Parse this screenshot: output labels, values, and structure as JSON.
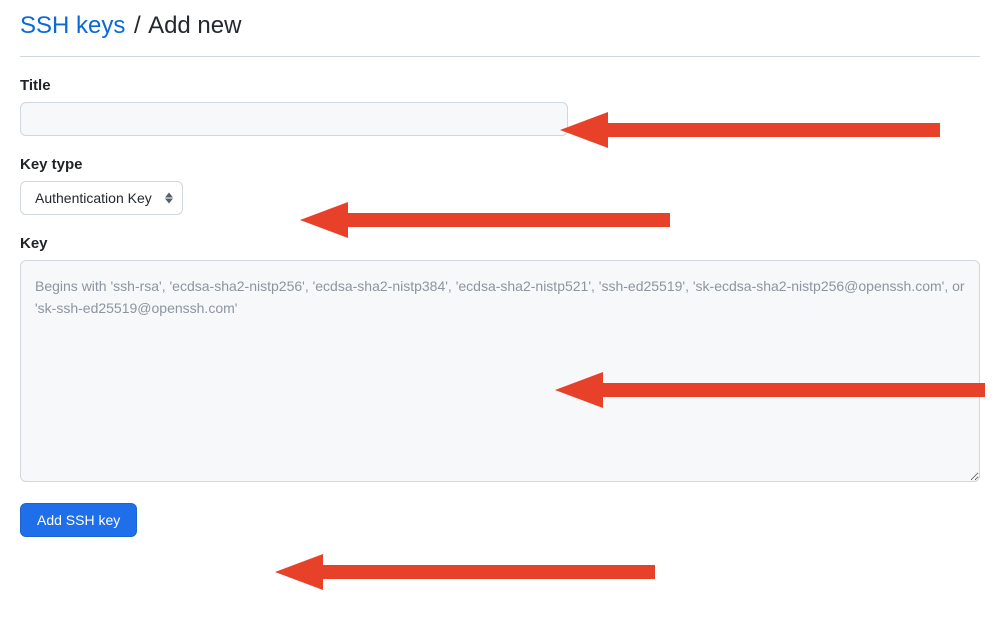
{
  "breadcrumb": {
    "parent_label": "SSH keys",
    "separator": "/",
    "current_label": "Add new"
  },
  "form": {
    "title": {
      "label": "Title",
      "value": ""
    },
    "key_type": {
      "label": "Key type",
      "selected": "Authentication Key"
    },
    "key": {
      "label": "Key",
      "value": "",
      "placeholder": "Begins with 'ssh-rsa', 'ecdsa-sha2-nistp256', 'ecdsa-sha2-nistp384', 'ecdsa-sha2-nistp521', 'ssh-ed25519', 'sk-ecdsa-sha2-nistp256@openssh.com', or 'sk-ssh-ed25519@openssh.com'"
    },
    "submit_label": "Add SSH key"
  },
  "annotations": {
    "arrow_color": "#e8412a"
  }
}
